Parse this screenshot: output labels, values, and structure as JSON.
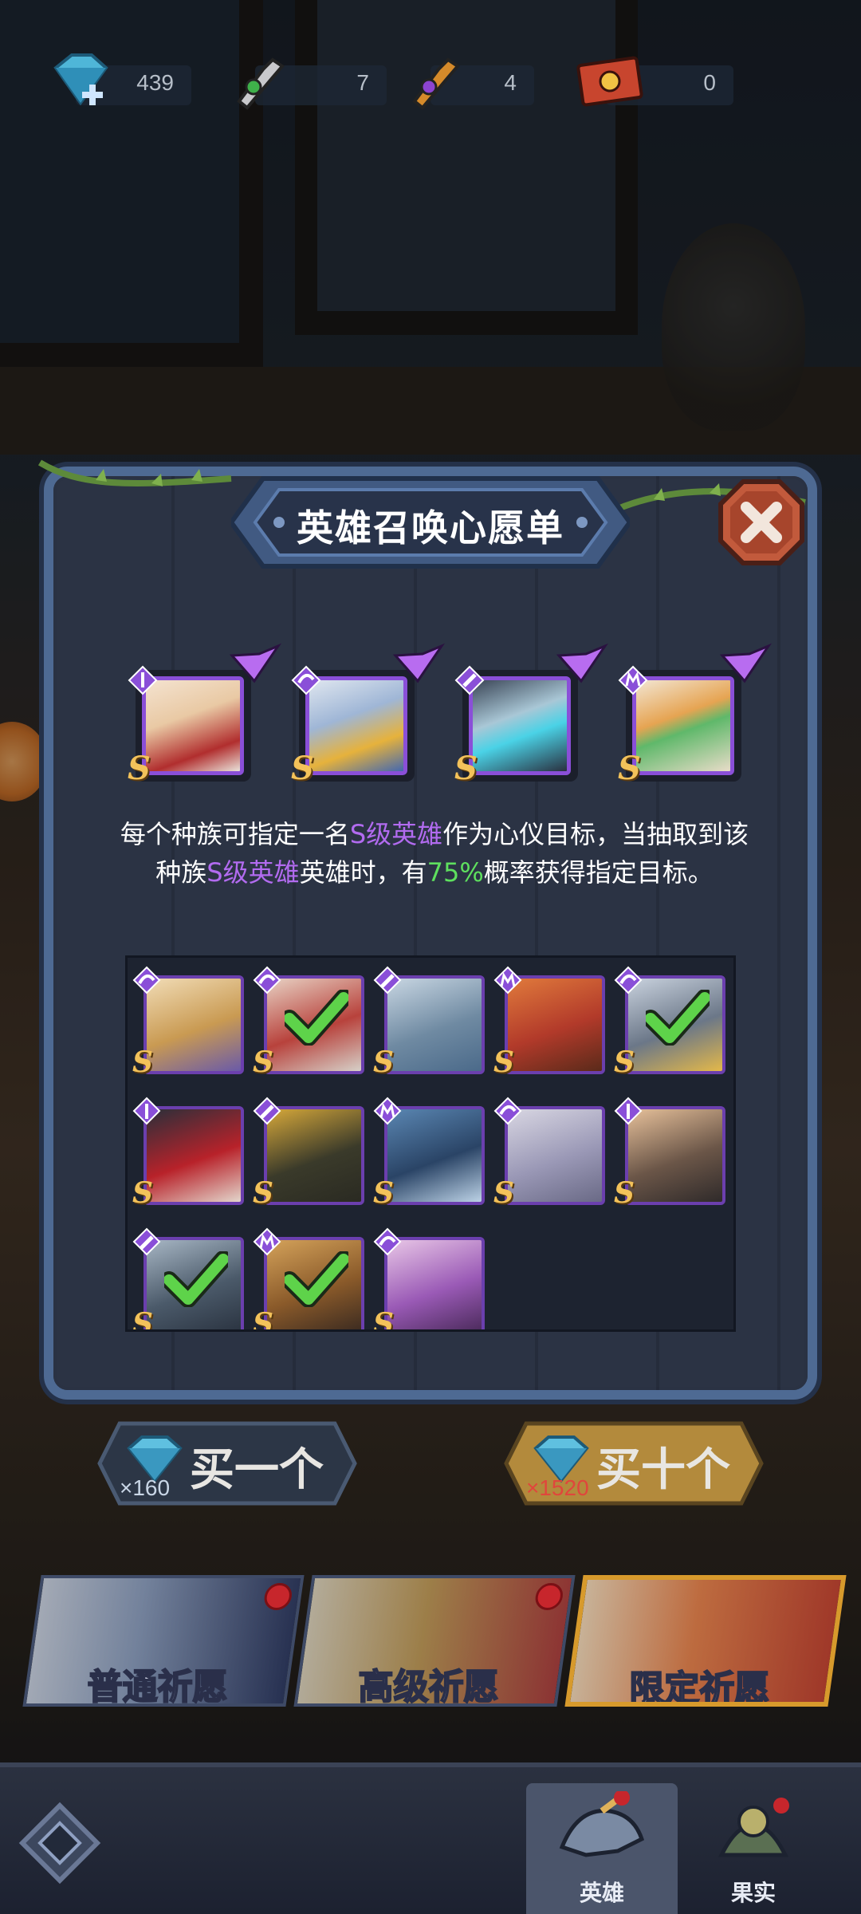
{
  "resources": [
    {
      "name": "diamond",
      "icon": "diamond-plus-icon",
      "value": "439"
    },
    {
      "name": "wrench-token",
      "icon": "green-wrench-icon",
      "value": "7"
    },
    {
      "name": "pipe-token",
      "icon": "purple-pipe-icon",
      "value": "4"
    },
    {
      "name": "ticket",
      "icon": "summon-ticket-icon",
      "value": "0"
    }
  ],
  "panel": {
    "title": "英雄召唤心愿单",
    "close_icon": "close-x-icon"
  },
  "featured": [
    {
      "name": "featured-hero-1",
      "rank": "S",
      "race": "kunlun",
      "wished": true
    },
    {
      "name": "featured-hero-2",
      "rank": "S",
      "race": "wing",
      "wished": true
    },
    {
      "name": "featured-hero-3",
      "rank": "S",
      "race": "wrench",
      "wished": true
    },
    {
      "name": "featured-hero-4",
      "rank": "S",
      "race": "beast",
      "wished": true
    }
  ],
  "description": {
    "p1": "每个种族可指定一名",
    "h1": "S级英雄",
    "p2": "作为心仪目标，当抽取到该种族",
    "h2": "S级英雄",
    "p3": "英雄时，有",
    "pct": "75%",
    "p4": "概率获得指定目标。"
  },
  "grid": [
    {
      "rank": "S",
      "race": "wing",
      "checked": false
    },
    {
      "rank": "S",
      "race": "wing",
      "checked": true
    },
    {
      "rank": "S",
      "race": "wrench",
      "checked": false
    },
    {
      "rank": "S",
      "race": "beast",
      "checked": false
    },
    {
      "rank": "S",
      "race": "wing",
      "checked": true
    },
    {
      "rank": "S",
      "race": "kunlun",
      "checked": false
    },
    {
      "rank": "S",
      "race": "wrench",
      "checked": false
    },
    {
      "rank": "S",
      "race": "beast",
      "checked": false
    },
    {
      "rank": "S",
      "race": "wing",
      "checked": false
    },
    {
      "rank": "S",
      "race": "kunlun",
      "checked": false
    },
    {
      "rank": "S",
      "race": "wrench",
      "checked": true
    },
    {
      "rank": "S",
      "race": "beast",
      "checked": true
    },
    {
      "rank": "S",
      "race": "wing",
      "checked": false
    }
  ],
  "buy_one": {
    "label": "买一个",
    "price": "×160",
    "price_color": "#c9d6e6"
  },
  "buy_ten": {
    "label": "买十个",
    "price": "×1520",
    "price_color": "#e0463c"
  },
  "banners": [
    {
      "label": "普通祈愿",
      "badge": true
    },
    {
      "label": "高级祈愿",
      "badge": true
    },
    {
      "label": "限定祈愿",
      "badge": false,
      "selected": true
    }
  ],
  "nav": [
    {
      "label": "英雄",
      "icon": "hero-helmet-icon",
      "selected": true
    },
    {
      "label": "果实",
      "icon": "fruit-icon",
      "selected": false
    }
  ],
  "colors": {
    "panel_border": "#4e6a93",
    "accent_purple": "#b26bf0",
    "accent_green": "#5ee05e",
    "rank_gold": "#f3c25a"
  }
}
